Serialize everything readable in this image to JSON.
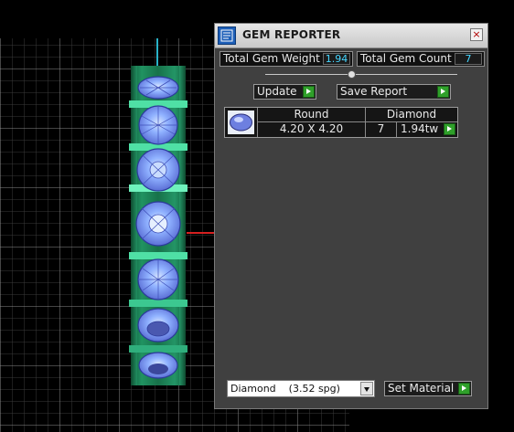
{
  "window": {
    "title": "GEM REPORTER"
  },
  "summary": {
    "weight_label": "Total Gem Weight",
    "weight_value": "1.94",
    "count_label": "Total Gem Count",
    "count_value": "7"
  },
  "toolbar": {
    "update_label": "Update",
    "save_label": "Save Report"
  },
  "gem_table": {
    "rows": [
      {
        "shape": "Round",
        "material": "Diamond",
        "size": "4.20 X 4.20",
        "count": "7",
        "weight": "1.94tw"
      }
    ]
  },
  "material": {
    "selected_name": "Diamond",
    "selected_sg": "(3.52 spg)",
    "set_label": "Set Material"
  },
  "colors": {
    "panel_bg": "#404040",
    "value_text": "#46d6ff",
    "go_button": "#2fa02a",
    "gem_blue": "#7f9cff",
    "setting_green": "#1e8c5a"
  },
  "icons": {
    "app": "gem-reporter-app-icon",
    "close": "close-icon",
    "play": "play-arrow-icon",
    "gem_thumb": "round-gem-icon"
  }
}
